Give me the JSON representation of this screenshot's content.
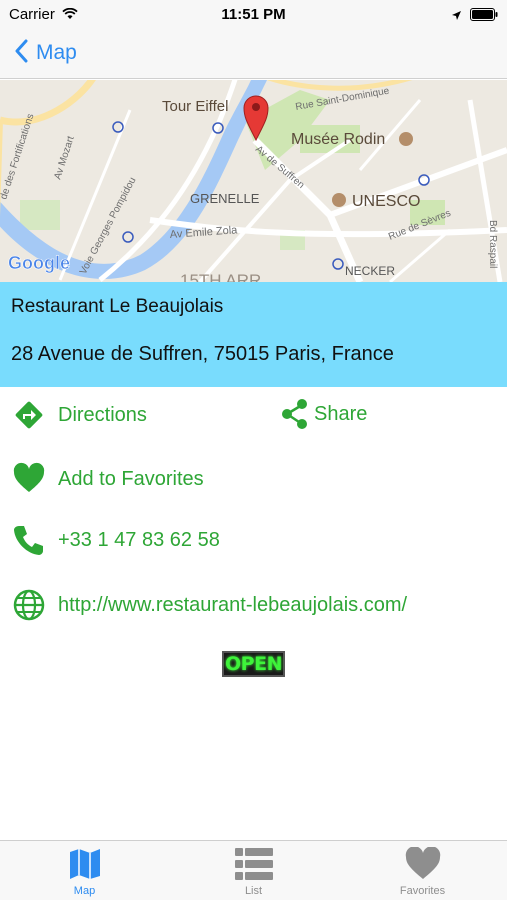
{
  "status_bar": {
    "carrier": "Carrier",
    "time": "11:51 PM"
  },
  "nav": {
    "back_label": "Map"
  },
  "map": {
    "labels": {
      "tour_eiffel": "Tour Eiffel",
      "rue_saint_dominique": "Rue Saint-Dominique",
      "musee_rodin": "Musée Rodin",
      "av_de_suffren": "Av de Suffren",
      "grenelle": "GRENELLE",
      "unesco": "UNESCO",
      "av_emile_zola": "Av Emile Zola",
      "rue_de_sevres": "Rue de Sèvres",
      "bd_raspail": "Bd Raspail",
      "necker": "NECKER",
      "arr_15": "15TH ARR.",
      "av_mozart": "Av Mozart",
      "voie_pompidou": "Voie Georges Pompidou",
      "fortifications": "de des Fortifications",
      "google": "Google"
    }
  },
  "place": {
    "name": "Restaurant Le Beaujolais",
    "address": "28 Avenue de Suffren, 75015 Paris, France"
  },
  "actions": {
    "directions": "Directions",
    "share": "Share",
    "favorites": "Add to Favorites",
    "phone": "+33 1 47 83 62 58",
    "website": "http://www.restaurant-lebeaujolais.com/"
  },
  "open_sign": "OPEN",
  "tabs": [
    {
      "label": "Map",
      "icon": "map-icon",
      "active": true
    },
    {
      "label": "List",
      "icon": "list-icon",
      "active": false
    },
    {
      "label": "Favorites",
      "icon": "heart-icon",
      "active": false
    }
  ],
  "colors": {
    "accent_blue": "#2e8cf0",
    "action_green": "#2ea636",
    "info_panel": "#79dcfd",
    "pin_red": "#e53935"
  }
}
